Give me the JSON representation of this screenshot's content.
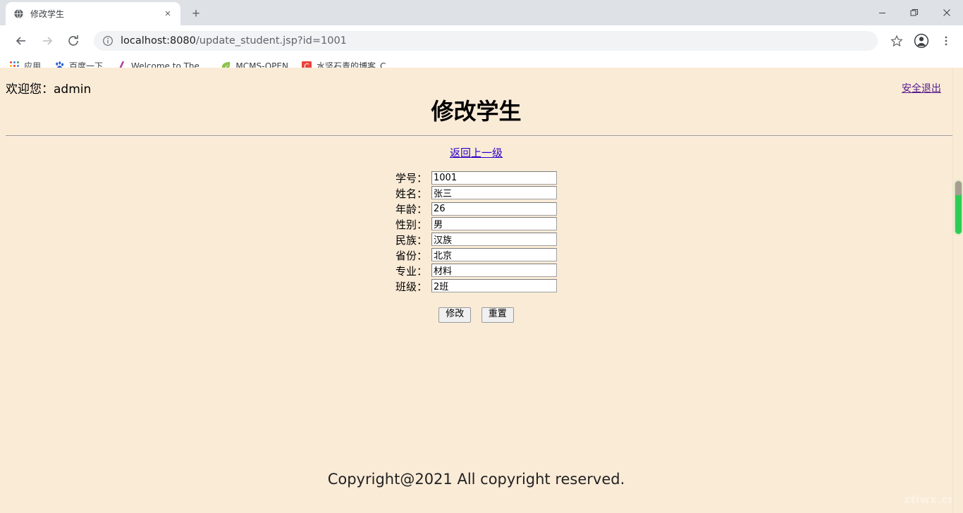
{
  "browser": {
    "tab": {
      "title": "修改学生",
      "favicon": "globe-icon",
      "close": "×"
    },
    "new_tab": "+",
    "window_controls": {
      "minimize": "—",
      "maximize": "❐",
      "close": "✕"
    },
    "nav": {
      "back": "←",
      "forward": "→",
      "reload": "⟳"
    },
    "omnibox": {
      "info_icon": "info-circle-icon",
      "url_host": "localhost:8080",
      "url_path": "/update_student.jsp?id=1001",
      "url_full": "localhost:8080/update_student.jsp?id=1001"
    },
    "toolbar_icons": {
      "bookmark": "star-icon",
      "profile": "avatar-icon",
      "menu": "three-dots-icon"
    },
    "bookmarks": [
      {
        "label": "应用",
        "icon": "apps-grid-icon"
      },
      {
        "label": "百度一下",
        "icon": "baidu-paw-icon"
      },
      {
        "label": "Welcome to The...",
        "icon": "slash-icon"
      },
      {
        "label": "MCMS-OPEN",
        "icon": "leaf-icon"
      },
      {
        "label": "水坚石青的博客_C...",
        "icon": "csdn-c-icon"
      }
    ]
  },
  "page": {
    "welcome": "欢迎您：admin",
    "logout_label": "安全退出",
    "title": "修改学生",
    "back_link": "返回上一级",
    "form": {
      "fields": [
        {
          "label": "学号：",
          "value": "1001",
          "name": "student-id"
        },
        {
          "label": "姓名：",
          "value": "张三",
          "name": "student-name"
        },
        {
          "label": "年龄：",
          "value": "26",
          "name": "student-age"
        },
        {
          "label": "性别：",
          "value": "男",
          "name": "student-gender"
        },
        {
          "label": "民族：",
          "value": "汉族",
          "name": "student-ethnicity"
        },
        {
          "label": "省份：",
          "value": "北京",
          "name": "student-province"
        },
        {
          "label": "专业：",
          "value": "材料",
          "name": "student-major"
        },
        {
          "label": "班级：",
          "value": "2班",
          "name": "student-class"
        }
      ],
      "submit_label": "修改",
      "reset_label": "重置"
    },
    "footer": "Copyright@2021 All copyright reserved.",
    "watermark": "ztiwx.cn"
  },
  "colors": {
    "page_background": "#faebd7",
    "link_unvisited": "#2a00c8",
    "link_visited": "#551a8b",
    "scrollbar_thumb": "#2ecc54",
    "browser_chrome": "#dee1e6"
  }
}
